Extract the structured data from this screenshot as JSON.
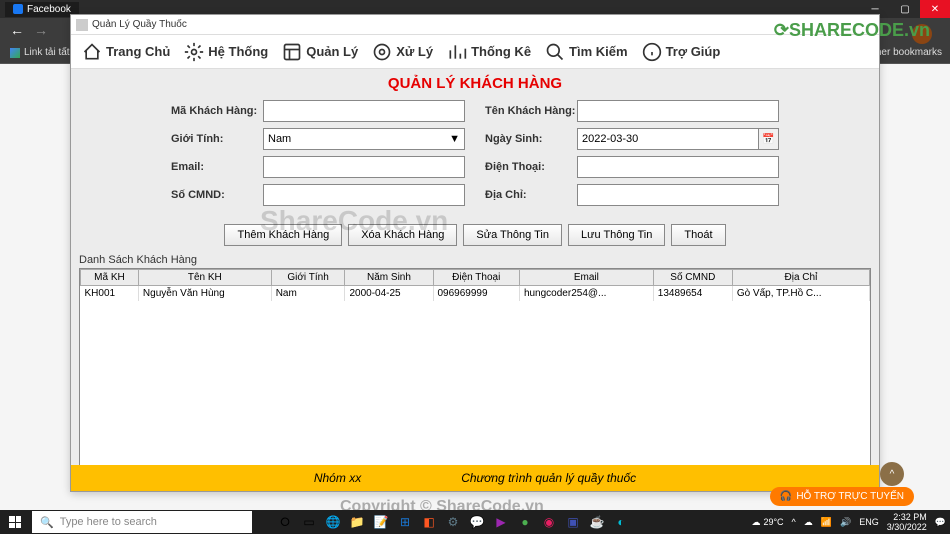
{
  "browser": {
    "tab_title": "Facebook",
    "bookmark": "Link tải tất",
    "other_bookmarks": "her bookmarks"
  },
  "app": {
    "window_title": "Quản Lý Quầy Thuốc",
    "toolbar": {
      "home": "Trang Chủ",
      "system": "Hệ Thống",
      "manage": "Quản Lý",
      "process": "Xử Lý",
      "stats": "Thống Kê",
      "search": "Tìm Kiếm",
      "help": "Trợ Giúp"
    },
    "page_title": "QUẢN LÝ KHÁCH HÀNG",
    "labels": {
      "ma_kh": "Mã Khách Hàng:",
      "ten_kh": "Tên Khách Hàng:",
      "gioi_tinh": "Giới Tính:",
      "ngay_sinh": "Ngày Sinh:",
      "email": "Email:",
      "dien_thoai": "Điện Thoại:",
      "cmnd": "Số CMND:",
      "dia_chi": "Địa Chỉ:"
    },
    "values": {
      "gioi_tinh": "Nam",
      "ngay_sinh": "2022-03-30"
    },
    "buttons": {
      "add": "Thêm Khách Hàng",
      "delete": "Xóa Khách Hàng",
      "edit": "Sửa Thông Tin",
      "save": "Lưu Thông Tin",
      "exit": "Thoát"
    },
    "list_label": "Danh Sách Khách Hàng",
    "columns": [
      "Mã KH",
      "Tên KH",
      "Giới Tính",
      "Năm Sinh",
      "Điện Thoại",
      "Email",
      "Số CMND",
      "Địa Chỉ"
    ],
    "rows": [
      [
        "KH001",
        "Nguyễn Văn Hùng",
        "Nam",
        "2000-04-25",
        "096969999",
        "hungcoder254@...",
        "13489654",
        "Gò Vấp, TP.Hồ C..."
      ]
    ],
    "footer": {
      "group": "Nhóm xx",
      "desc": "Chương trình quản lý quầy thuốc"
    }
  },
  "watermark": {
    "center": "ShareCode.vn",
    "bottom": "Copyright © ShareCode.vn",
    "logo": "SHARECODE.vn"
  },
  "support": "HỖ TRỢ TRỰC TUYẾN",
  "taskbar": {
    "search_placeholder": "Type here to search",
    "weather": "29°C",
    "lang": "ENG",
    "time": "2:32 PM",
    "date": "3/30/2022"
  }
}
